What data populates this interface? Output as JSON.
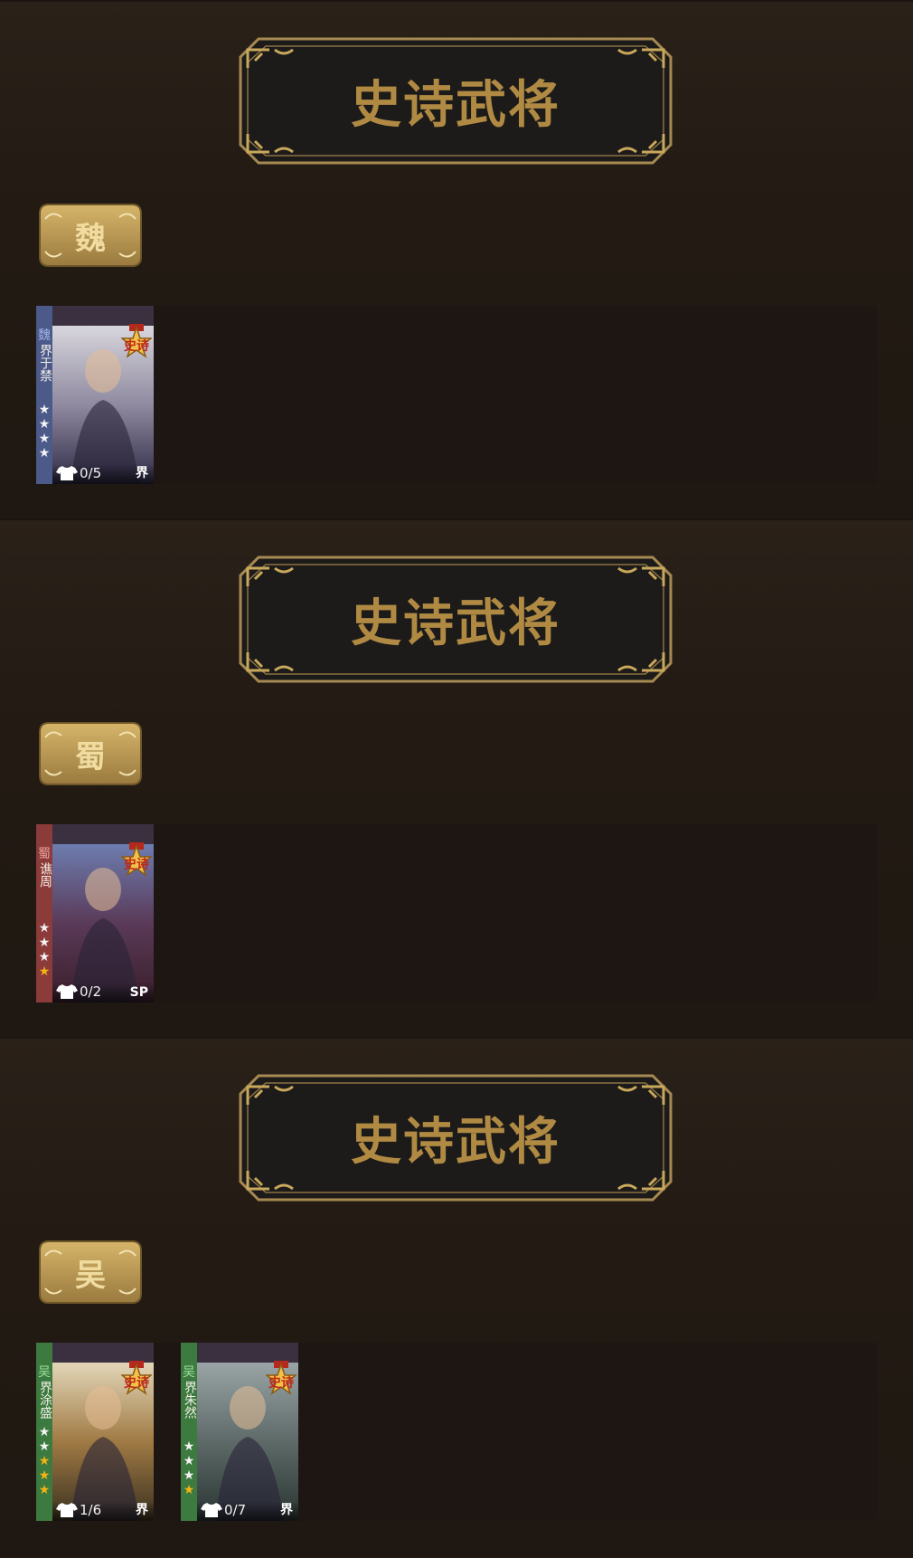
{
  "sections": [
    {
      "title": "史诗武将",
      "faction": "魏",
      "cards": [
        {
          "faction": "魏",
          "name": "界于禁",
          "stars_total": 4,
          "stars_gold": 0,
          "skins": "0/5",
          "edition": "界",
          "badge": "史诗",
          "side_color": "#4c5a8a",
          "faction_color": "#9fb2e6"
        }
      ]
    },
    {
      "title": "史诗武将",
      "faction": "蜀",
      "cards": [
        {
          "faction": "蜀",
          "name": "谯周",
          "stars_total": 4,
          "stars_gold": 1,
          "skins": "0/2",
          "edition": "SP",
          "badge": "史诗",
          "side_color": "#8c3b3b",
          "faction_color": "#e8a09a"
        }
      ]
    },
    {
      "title": "史诗武将",
      "faction": "吴",
      "cards": [
        {
          "faction": "吴",
          "name": "界涂盛",
          "stars_total": 5,
          "stars_gold": 3,
          "skins": "1/6",
          "edition": "界",
          "badge": "史诗",
          "side_color": "#3d7a3f",
          "faction_color": "#9be09a"
        },
        {
          "faction": "吴",
          "name": "界朱然",
          "stars_total": 4,
          "stars_gold": 1,
          "skins": "0/7",
          "edition": "界",
          "badge": "史诗",
          "side_color": "#3d7a3f",
          "faction_color": "#9be09a"
        }
      ]
    }
  ],
  "colors": {
    "gold": "#b08a43",
    "badge": "#c9a85c",
    "background": "#221a14"
  },
  "icons": {
    "skin": "shirt-icon",
    "star": "star-icon",
    "epic": "epic-rank-badge-icon"
  }
}
